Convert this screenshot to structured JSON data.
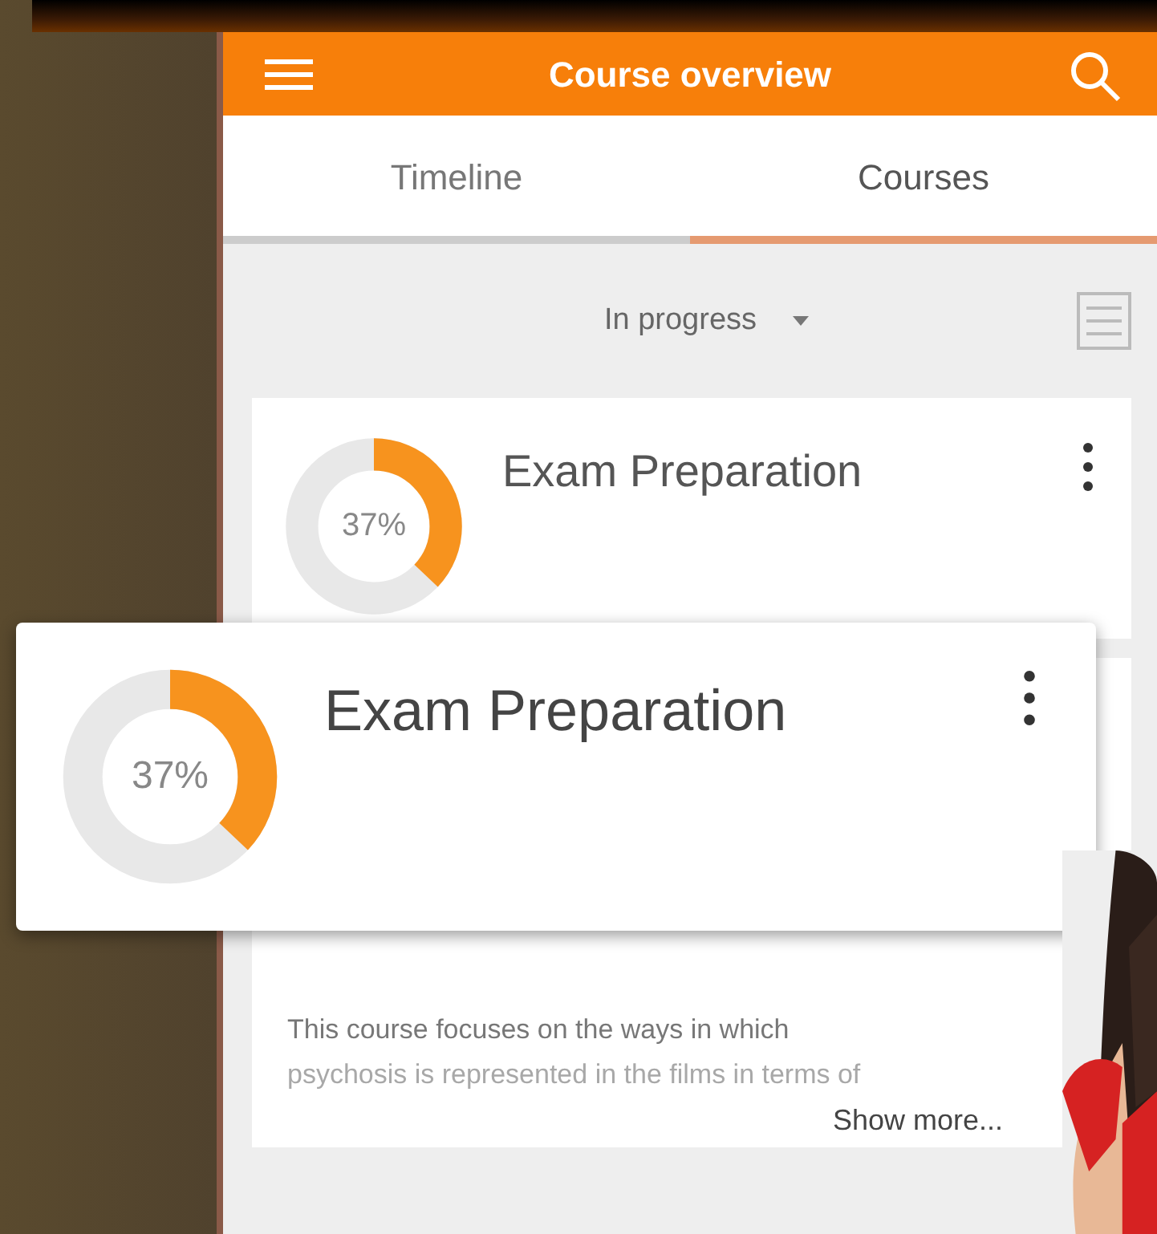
{
  "app_bar": {
    "title": "Course overview"
  },
  "tabs": [
    {
      "label": "Timeline",
      "selected": false
    },
    {
      "label": "Courses",
      "selected": true
    }
  ],
  "filter": {
    "label": "In progress"
  },
  "courses": [
    {
      "title": "Exam Preparation",
      "level": 0.37,
      "reading": "37%"
    }
  ],
  "zoomed_card": {
    "title": "Exam Preparation",
    "level": 0.37,
    "reading": "37%"
  },
  "description": {
    "lines": [
      "This course focuses on the ways in which",
      "psychosis is represented in the films in terms of"
    ],
    "link": "Show more..."
  }
}
